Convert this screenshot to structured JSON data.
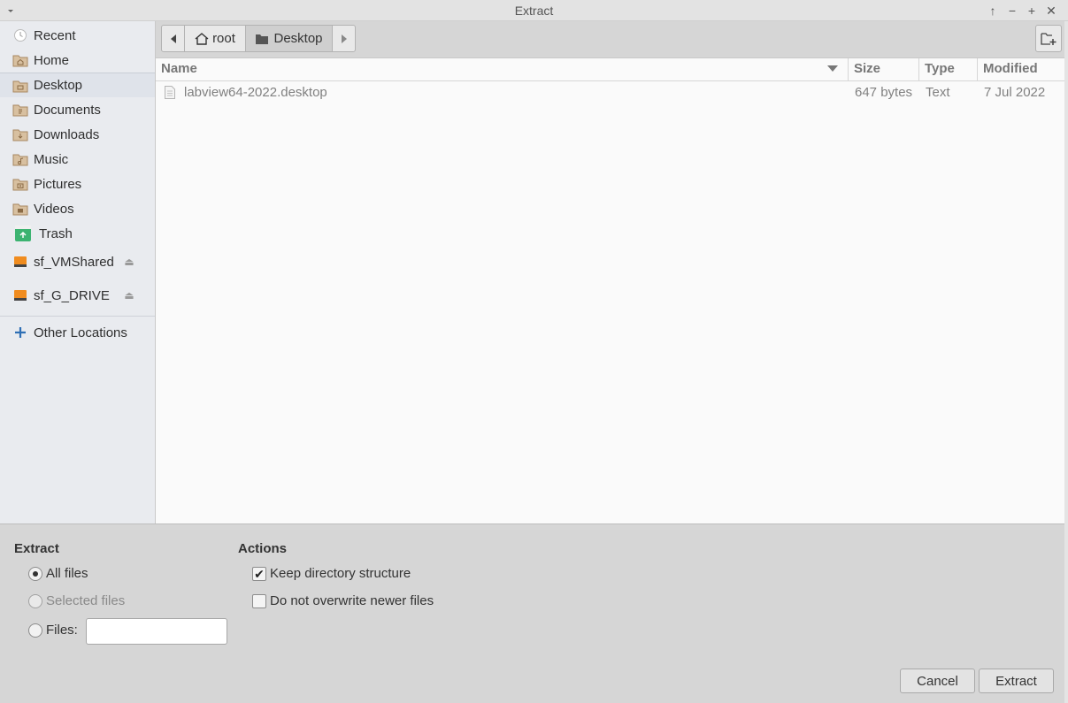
{
  "window": {
    "title": "Extract"
  },
  "sidebar": {
    "items": [
      {
        "label": "Recent",
        "icon": "clock-icon"
      },
      {
        "label": "Home",
        "icon": "home-folder-icon"
      },
      {
        "label": "Desktop",
        "icon": "desktop-folder-icon"
      },
      {
        "label": "Documents",
        "icon": "documents-folder-icon"
      },
      {
        "label": "Downloads",
        "icon": "downloads-folder-icon"
      },
      {
        "label": "Music",
        "icon": "music-folder-icon"
      },
      {
        "label": "Pictures",
        "icon": "pictures-folder-icon"
      },
      {
        "label": "Videos",
        "icon": "videos-folder-icon"
      },
      {
        "label": "Trash",
        "icon": "trash-icon"
      }
    ],
    "drives": [
      {
        "label": "sf_VMShared",
        "icon": "drive-icon"
      },
      {
        "label": "sf_G_DRIVE",
        "icon": "drive-icon"
      }
    ],
    "other": {
      "label": "Other Locations",
      "icon": "plus-icon"
    }
  },
  "pathbar": {
    "segments": [
      "root",
      "Desktop"
    ]
  },
  "filelist": {
    "columns": [
      "Name",
      "Size",
      "Type",
      "Modified"
    ],
    "rows": [
      {
        "name": "labview64-2022.desktop",
        "size": "647 bytes",
        "type": "Text",
        "modified": "7 Jul 2022"
      }
    ]
  },
  "options": {
    "extract_title": "Extract",
    "all_files": "All files",
    "selected_files": "Selected files",
    "files_label": "Files:",
    "files_value": "",
    "actions_title": "Actions",
    "keep_structure": "Keep directory structure",
    "no_overwrite": "Do not overwrite newer files"
  },
  "buttons": {
    "cancel": "Cancel",
    "extract": "Extract"
  },
  "colors": {
    "folder": "#c9a882",
    "trash": "#3cb371",
    "drive": "#f08c1f",
    "plus": "#2f6fb5"
  }
}
